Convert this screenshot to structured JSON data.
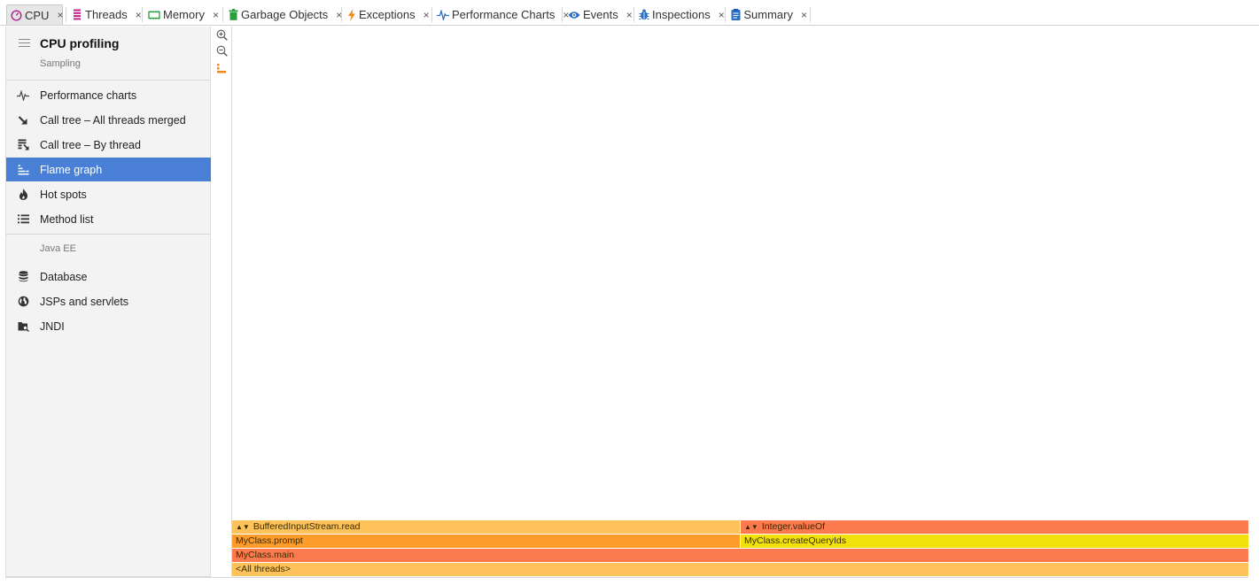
{
  "tabs": [
    {
      "label": "CPU",
      "icon": "cpu-icon",
      "color": "#b0208f",
      "active": true
    },
    {
      "label": "Threads",
      "icon": "threads-icon",
      "color": "#c0208a"
    },
    {
      "label": "Memory",
      "icon": "memory-icon",
      "color": "#2a9d3c"
    },
    {
      "label": "Garbage Objects",
      "icon": "trash-icon",
      "color": "#2a9d3c"
    },
    {
      "label": "Exceptions",
      "icon": "lightning-icon",
      "color": "#f08a14"
    },
    {
      "label": "Performance Charts",
      "icon": "pulse-icon",
      "color": "#2b6fc4"
    },
    {
      "label": "Events",
      "icon": "eye-icon",
      "color": "#2b6fc4"
    },
    {
      "label": "Inspections",
      "icon": "bug-icon",
      "color": "#2b6fc4"
    },
    {
      "label": "Summary",
      "icon": "clipboard-icon",
      "color": "#2b6fc4"
    }
  ],
  "tab_close": "×",
  "panel": {
    "title": "CPU profiling",
    "subtitle": "Sampling",
    "items": [
      {
        "label": "Performance charts",
        "icon": "pulse-icon"
      },
      {
        "label": "Call tree – All threads merged",
        "icon": "arrow-down-right-icon"
      },
      {
        "label": "Call tree – By thread",
        "icon": "thread-tree-icon"
      },
      {
        "label": "Flame graph",
        "icon": "flame-graph-icon",
        "selected": true
      },
      {
        "label": "Hot spots",
        "icon": "fire-icon"
      },
      {
        "label": "Method list",
        "icon": "list-icon"
      }
    ],
    "section_label": "Java EE",
    "section_items": [
      {
        "label": "Database",
        "icon": "database-icon"
      },
      {
        "label": "JSPs and servlets",
        "icon": "globe-icon"
      },
      {
        "label": "JNDI",
        "icon": "folder-search-icon"
      }
    ]
  },
  "colors": {
    "selected": "#4a7fd6",
    "frame_orange_light": "#fdc35a",
    "frame_orange": "#fd9c2b",
    "frame_red": "#fc7a4e",
    "frame_yellow": "#f1e20c"
  },
  "flame": {
    "frames": [
      {
        "label": "BufferedInputStream.read",
        "collapsed": true,
        "color": "#fdc35a"
      },
      {
        "label": "Integer.valueOf",
        "collapsed": true,
        "color": "#fc7a4e"
      },
      {
        "label": "MyClass.prompt",
        "color": "#fd9c2b"
      },
      {
        "label": "MyClass.createQueryIds",
        "color": "#f1e20c"
      },
      {
        "label": "MyClass.main",
        "color": "#fc7a4e"
      },
      {
        "label": "<All threads>",
        "color": "#fdc35a"
      }
    ]
  }
}
